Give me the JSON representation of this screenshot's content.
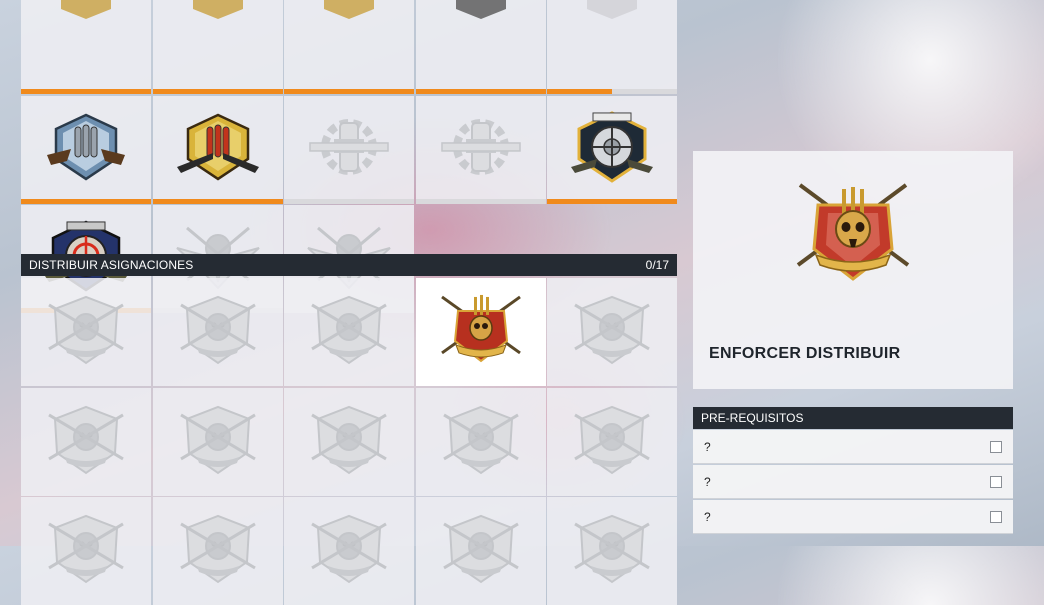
{
  "grid_top": {
    "tiles": [
      {
        "row": 0,
        "col": 0,
        "progress": 1.0,
        "style": "gold-partial",
        "unlocked": true
      },
      {
        "row": 0,
        "col": 1,
        "progress": 1.0,
        "style": "gold-partial",
        "unlocked": true
      },
      {
        "row": 0,
        "col": 2,
        "progress": 1.0,
        "style": "gold-partial",
        "unlocked": true
      },
      {
        "row": 0,
        "col": 3,
        "progress": 1.0,
        "style": "dark-partial",
        "unlocked": true
      },
      {
        "row": 0,
        "col": 4,
        "progress": 0.5,
        "style": "grey-partial",
        "unlocked": false
      },
      {
        "row": 1,
        "col": 0,
        "progress": 1.0,
        "style": "blue-ammo",
        "unlocked": true
      },
      {
        "row": 1,
        "col": 1,
        "progress": 1.0,
        "style": "gold-ammo",
        "unlocked": true
      },
      {
        "row": 1,
        "col": 2,
        "progress": 0,
        "style": "locked-wrench",
        "unlocked": false
      },
      {
        "row": 1,
        "col": 3,
        "progress": 0,
        "style": "locked-wrench",
        "unlocked": false
      },
      {
        "row": 1,
        "col": 4,
        "progress": 1.0,
        "style": "gold-target",
        "unlocked": true
      },
      {
        "row": 2,
        "col": 0,
        "progress": 1.0,
        "style": "blue-crosshair",
        "unlocked": true
      },
      {
        "row": 2,
        "col": 1,
        "progress": 0,
        "style": "locked-wings",
        "unlocked": false
      },
      {
        "row": 2,
        "col": 2,
        "progress": null,
        "style": "locked-wings",
        "unlocked": false
      }
    ]
  },
  "distribuir": {
    "title": "DISTRIBUIR ASIGNACIONES",
    "count": "0/17",
    "tiles": [
      {
        "row": 0,
        "col": 0,
        "style": "locked-skull",
        "active": false
      },
      {
        "row": 0,
        "col": 1,
        "style": "locked-skull",
        "active": false
      },
      {
        "row": 0,
        "col": 2,
        "style": "locked-skull",
        "active": false
      },
      {
        "row": 0,
        "col": 3,
        "style": "enforcer",
        "active": true
      },
      {
        "row": 0,
        "col": 4,
        "style": "locked-skull",
        "active": false
      },
      {
        "row": 1,
        "col": 0,
        "style": "locked-skull",
        "active": false
      },
      {
        "row": 1,
        "col": 1,
        "style": "locked-skull",
        "active": false
      },
      {
        "row": 1,
        "col": 2,
        "style": "locked-skull",
        "active": false
      },
      {
        "row": 1,
        "col": 3,
        "style": "locked-skull",
        "active": false
      },
      {
        "row": 1,
        "col": 4,
        "style": "locked-skull",
        "active": false
      },
      {
        "row": 2,
        "col": 0,
        "style": "locked-skull",
        "active": false
      },
      {
        "row": 2,
        "col": 1,
        "style": "locked-skull",
        "active": false
      },
      {
        "row": 2,
        "col": 2,
        "style": "locked-skull",
        "active": false
      },
      {
        "row": 2,
        "col": 3,
        "style": "locked-skull",
        "active": false
      },
      {
        "row": 2,
        "col": 4,
        "style": "locked-skull",
        "active": false
      }
    ]
  },
  "detail": {
    "name": "ENFORCER DISTRIBUIR"
  },
  "prereqs": {
    "title": "PRE-REQUISITOS",
    "items": [
      {
        "label": "?"
      },
      {
        "label": "?"
      },
      {
        "label": "?"
      }
    ]
  },
  "colors": {
    "accent_orange": "#f08a1c",
    "header_dark": "#252b33"
  }
}
